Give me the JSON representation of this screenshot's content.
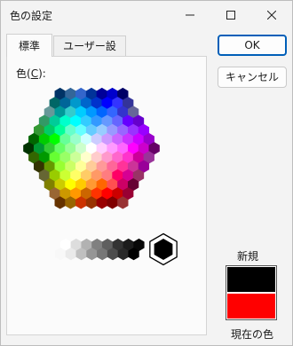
{
  "window": {
    "title": "色の設定"
  },
  "tabs": [
    {
      "label": "標準",
      "active": true
    },
    {
      "label": "ユーザー設定",
      "active": false
    }
  ],
  "panel": {
    "color_label_prefix": "色(",
    "color_label_key": "C",
    "color_label_suffix": "):"
  },
  "buttons": {
    "ok": "OK",
    "cancel": "キャンセル"
  },
  "preview": {
    "new_label": "新規",
    "current_label": "現在の色",
    "new_color": "#000000",
    "current_color": "#ff0000"
  },
  "palette": {
    "hex_rows": [
      [
        "#003366",
        "#336699",
        "#3366cc",
        "#003399",
        "#000099",
        "#0000cc",
        "#000066"
      ],
      [
        "#006666",
        "#006699",
        "#0099cc",
        "#0066cc",
        "#0033cc",
        "#0000ff",
        "#3333ff",
        "#333399"
      ],
      [
        "#669999",
        "#009999",
        "#33cccc",
        "#00ccff",
        "#0099ff",
        "#0066ff",
        "#3366ff",
        "#3333cc",
        "#666699"
      ],
      [
        "#339966",
        "#00cc99",
        "#00ffcc",
        "#00ffff",
        "#33ccff",
        "#3399ff",
        "#6699ff",
        "#6666ff",
        "#6600ff",
        "#6600cc"
      ],
      [
        "#339933",
        "#00cc66",
        "#00ff99",
        "#66ffcc",
        "#66ffff",
        "#66ccff",
        "#99ccff",
        "#9999ff",
        "#9966ff",
        "#9933ff",
        "#9900ff"
      ],
      [
        "#006600",
        "#00cc00",
        "#00ff00",
        "#66ff99",
        "#99ffcc",
        "#ccffff",
        "#ccccff",
        "#cc99ff",
        "#cc66ff",
        "#cc33ff",
        "#cc00ff",
        "#9900cc"
      ],
      [
        "#003300",
        "#009933",
        "#33cc33",
        "#66ff66",
        "#99ff99",
        "#ccffcc",
        "#ffffff",
        "#ffccff",
        "#ff99ff",
        "#ff66ff",
        "#ff00ff",
        "#cc00cc",
        "#660066"
      ],
      [
        "#336600",
        "#009900",
        "#66ff33",
        "#99ff66",
        "#ccff99",
        "#ffffcc",
        "#ffcccc",
        "#ff99cc",
        "#ff66cc",
        "#ff33cc",
        "#cc0099",
        "#993399"
      ],
      [
        "#333300",
        "#669900",
        "#99ff33",
        "#ccff66",
        "#ffff99",
        "#ffcc99",
        "#ff9999",
        "#ff6699",
        "#ff3399",
        "#cc3399",
        "#990099"
      ],
      [
        "#666633",
        "#99cc00",
        "#ccff33",
        "#ffff66",
        "#ffcc66",
        "#ff9966",
        "#ff7c80",
        "#ff0066",
        "#d60093",
        "#993366"
      ],
      [
        "#808000",
        "#cccc00",
        "#ffff00",
        "#ffcc00",
        "#ff9933",
        "#ff6600",
        "#ff5050",
        "#cc0066",
        "#660033"
      ],
      [
        "#996633",
        "#cc9900",
        "#ff9900",
        "#cc6600",
        "#ff3300",
        "#ff0000",
        "#cc0000",
        "#990033"
      ],
      [
        "#663300",
        "#996600",
        "#cc3300",
        "#993300",
        "#990000",
        "#800000",
        "#993333"
      ]
    ],
    "gray_top": [
      "#ffffff",
      "#dddddd",
      "#b2b2b2",
      "#808080",
      "#5f5f5f",
      "#333333",
      "#1c1c1c",
      "#080808"
    ],
    "gray_bottom": [
      "#f8f8f8",
      "#eaeaea",
      "#c0c0c0",
      "#969696",
      "#777777",
      "#4d4d4d",
      "#292929",
      "#000000"
    ],
    "selected_color": "#000000"
  }
}
